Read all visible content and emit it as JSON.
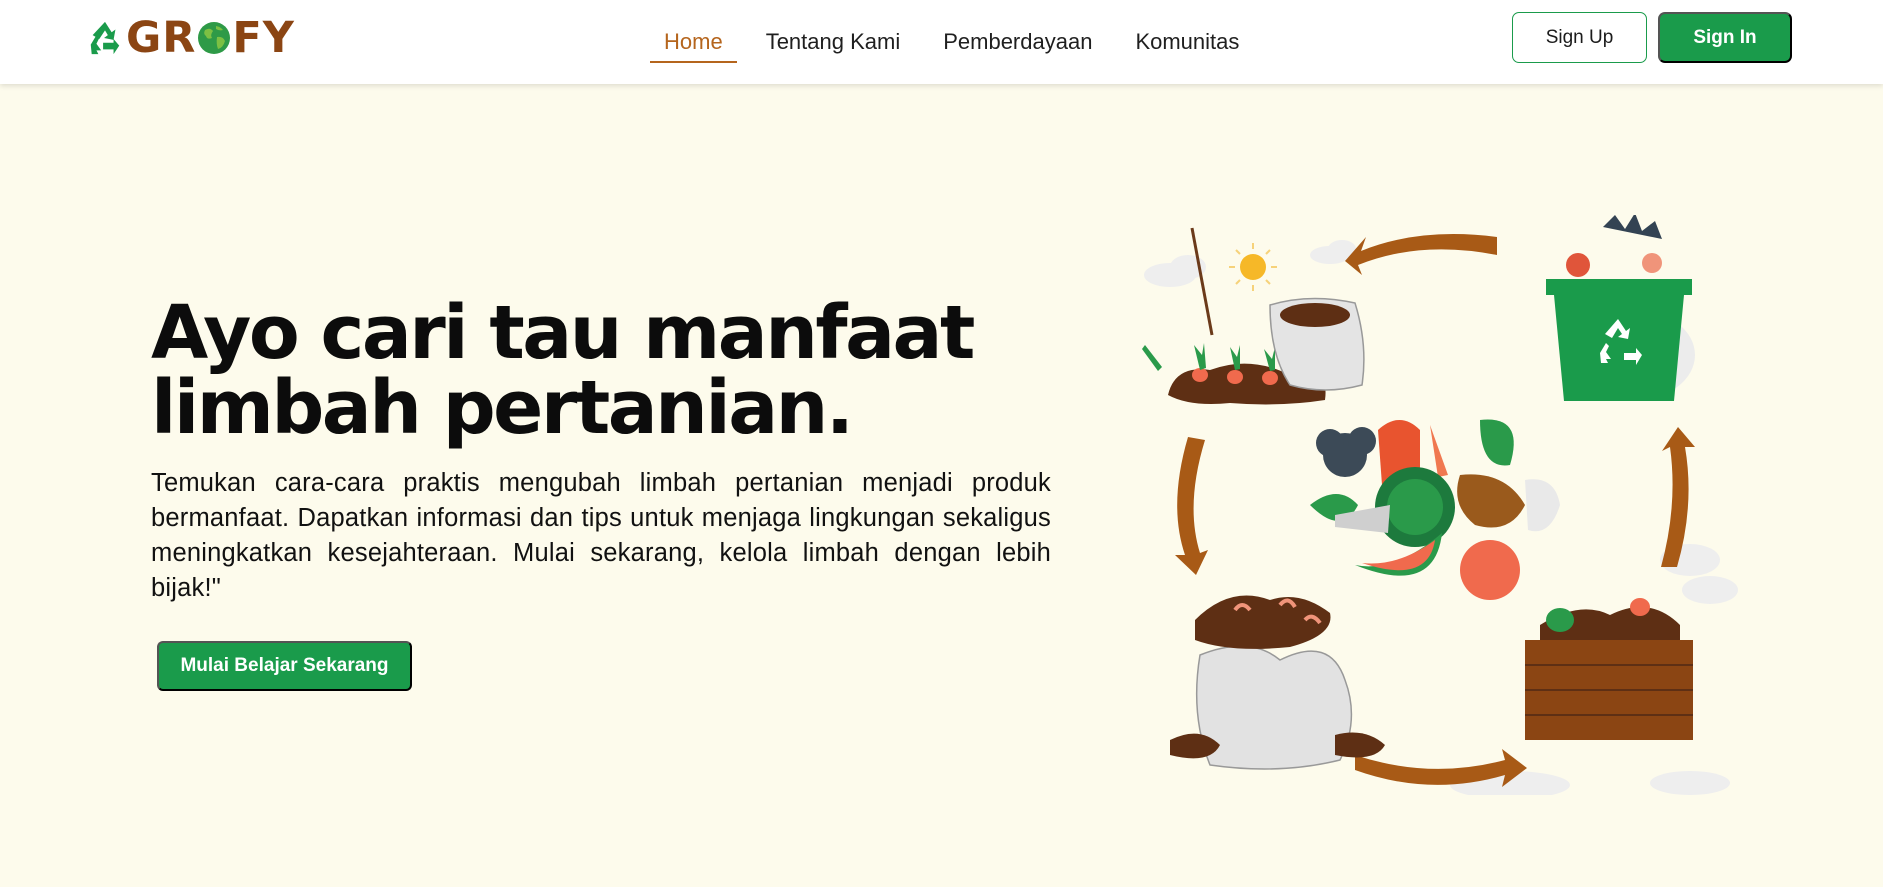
{
  "brand": {
    "name_before": "GR",
    "name_after": "FY"
  },
  "nav": {
    "links": [
      {
        "label": "Home",
        "active": true
      },
      {
        "label": "Tentang Kami",
        "active": false
      },
      {
        "label": "Pemberdayaan",
        "active": false
      },
      {
        "label": "Komunitas",
        "active": false
      }
    ],
    "signup_label": "Sign Up",
    "signin_label": "Sign In"
  },
  "hero": {
    "title_line1": "Ayo cari tau manfaat",
    "title_line2": "limbah pertanian.",
    "description": "Temukan cara-cara praktis mengubah limbah pertanian menjadi produk bermanfaat. Dapatkan informasi dan tips untuk menjaga lingkungan sekaligus meningkatkan kesejahteraan. Mulai sekarang, kelola limbah dengan lebih bijak!\"",
    "cta_label": "Mulai Belajar Sekarang"
  },
  "illustration": {
    "name": "recycling-cycle-illustration"
  },
  "colors": {
    "accent_green": "#1a9b4b",
    "accent_brown": "#b5651d",
    "logo_brown": "#8b4513",
    "background": "#fdfbec",
    "arrow_brown": "#a85a16"
  }
}
